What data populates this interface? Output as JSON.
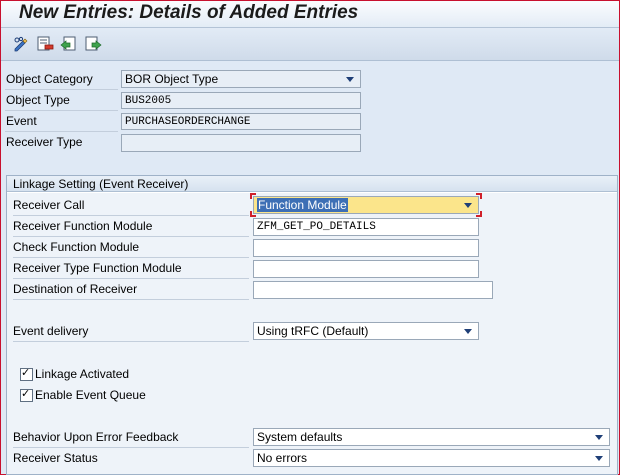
{
  "window": {
    "title": "New Entries: Details of Added Entries"
  },
  "toolbar": {
    "icons": [
      "display-change-icon",
      "delete-icon",
      "previous-entry-icon",
      "next-entry-icon"
    ]
  },
  "header_fields": {
    "object_category": {
      "label": "Object Category",
      "value": "BOR Object Type"
    },
    "object_type": {
      "label": "Object Type",
      "value": "BUS2005"
    },
    "event": {
      "label": "Event",
      "value": "PURCHASEORDERCHANGE"
    },
    "receiver_type": {
      "label": "Receiver Type",
      "value": ""
    }
  },
  "linkage": {
    "title": "Linkage Setting (Event Receiver)",
    "receiver_call": {
      "label": "Receiver Call",
      "value": "Function Module"
    },
    "receiver_function_module": {
      "label": "Receiver Function Module",
      "value": "ZFM_GET_PO_DETAILS"
    },
    "check_function_module": {
      "label": "Check Function Module",
      "value": ""
    },
    "receiver_type_function_module": {
      "label": "Receiver Type Function Module",
      "value": ""
    },
    "destination_of_receiver": {
      "label": "Destination of Receiver",
      "value": ""
    },
    "event_delivery": {
      "label": "Event delivery",
      "value": "Using tRFC (Default)"
    },
    "linkage_activated": {
      "label": "Linkage Activated",
      "checked": true
    },
    "enable_event_queue": {
      "label": "Enable Event Queue",
      "checked": true
    },
    "behavior_on_error": {
      "label": "Behavior Upon Error Feedback",
      "value": "System defaults"
    },
    "receiver_status": {
      "label": "Receiver Status",
      "value": "No errors"
    }
  },
  "colors": {
    "accent": "#1f3f77",
    "focus_highlight": "#fbe58b",
    "selection": "#3d6fb5",
    "frame_border": "#c8102e"
  }
}
